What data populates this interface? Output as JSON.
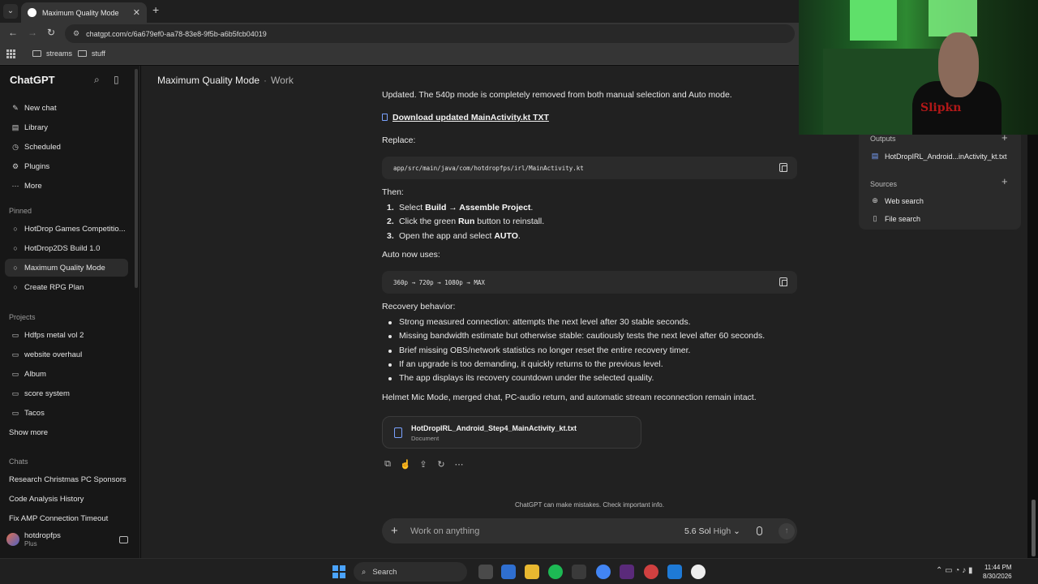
{
  "browser": {
    "tab_title": "Maximum Quality Mode",
    "url": "chatgpt.com/c/6a679ef0-aa78-83e8-9f5b-a6b5fcb04019",
    "bookmarks": [
      "streams",
      "stuff"
    ]
  },
  "sidebar": {
    "brand": "ChatGPT",
    "nav": [
      "New chat",
      "Library",
      "Scheduled",
      "Plugins",
      "More"
    ],
    "pinned_heading": "Pinned",
    "pinned": [
      "HotDrop Games Competitio...",
      "HotDrop2DS Build 1.0",
      "Maximum Quality Mode",
      "Create RPG Plan"
    ],
    "projects_heading": "Projects",
    "projects": [
      "Hdfps metal vol 2",
      "website overhaul",
      "Album",
      "score system",
      "Tacos"
    ],
    "show_more": "Show more",
    "chats_heading": "Chats",
    "chats": [
      "Research Christmas PC Sponsors",
      "Code Analysis History",
      "Fix AMP Connection Timeout"
    ],
    "user_name": "hotdropfps",
    "user_plan": "Plus"
  },
  "header": {
    "title": "Maximum Quality Mode",
    "workspace": "Work"
  },
  "message": {
    "intro": "Updated. The 540p mode is completely removed from both manual selection and Auto mode.",
    "download_link": "Download updated MainActivity.kt TXT",
    "replace_label": "Replace:",
    "replace_code": "app/src/main/java/com/hotdropfps/irl/MainActivity.kt",
    "then_label": "Then:",
    "steps": [
      {
        "n": "1.",
        "a": "Select ",
        "b": "Build → Assemble Project",
        "c": "."
      },
      {
        "n": "2.",
        "a": "Click the green ",
        "b": "Run",
        "c": " button to reinstall."
      },
      {
        "n": "3.",
        "a": "Open the app and select ",
        "b": "AUTO",
        "c": "."
      }
    ],
    "auto_label": "Auto now uses:",
    "auto_code": "360p → 720p → 1080p → MAX",
    "recovery_label": "Recovery behavior:",
    "recovery_items": [
      "Strong measured connection: attempts the next level after 30 stable seconds.",
      "Missing bandwidth estimate but otherwise stable: cautiously tests the next level after 60 seconds.",
      "Brief missing OBS/network statistics no longer reset the entire recovery timer.",
      "If an upgrade is too demanding, it quickly returns to the previous level.",
      "The app displays its recovery countdown under the selected quality."
    ],
    "closing": "Helmet Mic Mode, merged chat, PC-audio return, and automatic stream reconnection remain intact.",
    "file_name": "HotDropIRL_Android_Step4_MainActivity_kt.txt",
    "file_type": "Document"
  },
  "footer": {
    "disclaimer": "ChatGPT can make mistakes. Check important info.",
    "placeholder": "Work on anything",
    "model": "5.6 Sol",
    "effort": "High"
  },
  "right_panel": {
    "outputs_label": "Outputs",
    "output_file": "HotDropIRL_Android...inActivity_kt.txt",
    "sources_label": "Sources",
    "sources": [
      "Web search",
      "File search"
    ]
  },
  "taskbar": {
    "search": "Search",
    "time": "11:44 PM",
    "date": "8/30/2026"
  },
  "webcam": {
    "shirt_text": "Slipkn"
  },
  "colors": {
    "accent_blue": "#7aa2ff",
    "background": "#212121",
    "sidebar": "#171717"
  }
}
